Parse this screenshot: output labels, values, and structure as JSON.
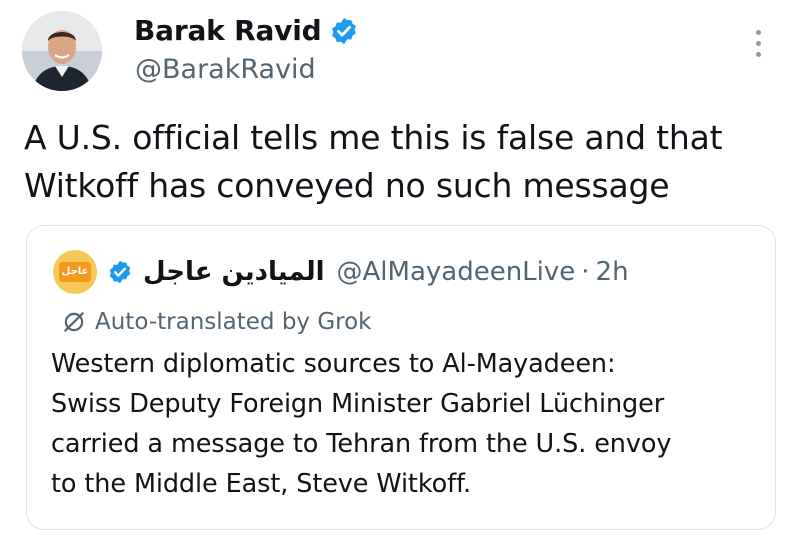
{
  "tweet": {
    "author_name": "Barak Ravid",
    "author_handle": "@BarakRavid",
    "text_line1": "A U.S. official tells me this is false and that",
    "text_line2": "Witkoff has conveyed no such message"
  },
  "quote": {
    "logo_text": "عاجل",
    "author_name": "الميادين عاجل",
    "author_handle": "@AlMayadeenLive",
    "separator": "·",
    "time": "2h",
    "translation_label": "Auto-translated by Grok",
    "text_lines": [
      "Western diplomatic sources to Al-Mayadeen:",
      "Swiss Deputy Foreign Minister Gabriel Lüchinger",
      "carried a message to Tehran from the U.S. envoy",
      "to the Middle East, Steve Witkoff."
    ]
  },
  "colors": {
    "verified_blue": "#1d9bf0",
    "secondary_text": "#536471",
    "border": "#dde3e8"
  },
  "icons": {
    "verified": "verified-badge-icon",
    "more": "more-vertical-icon",
    "translate": "translate-slash-icon"
  }
}
